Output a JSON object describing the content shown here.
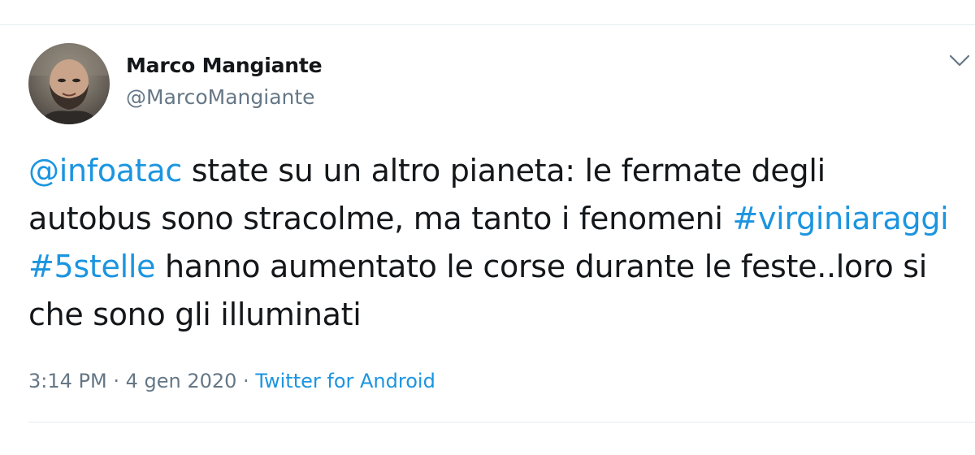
{
  "tweet": {
    "author": {
      "name": "Marco Mangiante",
      "handle": "@MarcoMangiante"
    },
    "text_segments": [
      {
        "text": "@infoatac",
        "type": "mention"
      },
      {
        "text": " state su un altro pianeta: le fermate degli autobus sono stracolme, ma tanto i fenomeni ",
        "type": "text"
      },
      {
        "text": "#virginiaraggi",
        "type": "hashtag"
      },
      {
        "text": " ",
        "type": "text"
      },
      {
        "text": "#5stelle",
        "type": "hashtag"
      },
      {
        "text": " hanno aumentato le corse durante le feste..loro si che sono gli illuminati",
        "type": "text"
      }
    ],
    "meta": {
      "time": "3:14 PM",
      "separator": " · ",
      "date": "4 gen 2020",
      "source": "Twitter for Android"
    }
  },
  "icons": {
    "menu": "chevron-down-icon",
    "avatar": "avatar"
  },
  "colors": {
    "link": "#1b95e0",
    "secondary_text": "#657786",
    "primary_text": "#14171a",
    "divider": "#e6ecf0"
  }
}
